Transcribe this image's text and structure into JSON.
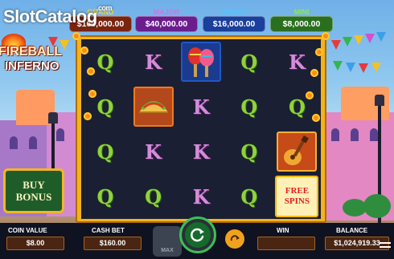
{
  "site_logo": {
    "text": "SlotCatalog",
    "suffix": ".com"
  },
  "game_logo": {
    "line1": "FIREBALL",
    "line2": "INFERNO"
  },
  "jackpots": [
    {
      "label": "GRAND",
      "value": "$160,000.00",
      "color": "#f8d037"
    },
    {
      "label": "MAJOR",
      "value": "$40,000.00",
      "color": "#d86fe8"
    },
    {
      "label": "MINOR",
      "value": "$16,000.00",
      "color": "#4fc4ff"
    },
    {
      "label": "MINI",
      "value": "$8,000.00",
      "color": "#8fe45a"
    }
  ],
  "reels": [
    [
      "Q",
      "K",
      "maracas",
      "Q",
      "K"
    ],
    [
      "Q",
      "taco",
      "K",
      "Q",
      "Q"
    ],
    [
      "Q",
      "K",
      "K",
      "Q",
      "guitar"
    ],
    [
      "Q",
      "Q",
      "K",
      "Q",
      "free-spins"
    ]
  ],
  "free_spins_label": [
    "FREE",
    "SPINS"
  ],
  "buy_bonus": {
    "line1": "BUY",
    "line2": "BONUS"
  },
  "bottom_bar": {
    "coin_value_label": "COIN VALUE",
    "coin_value": "$8.00",
    "cash_bet_label": "CASH BET",
    "cash_bet": "$160.00",
    "max_label": "MAX",
    "win_label": "WIN",
    "win_value": "",
    "balance_label": "BALANCE",
    "balance_value": "$1,024,919.33"
  },
  "colors": {
    "frame": "#f3b31b",
    "reel_bg": "#1b1f33",
    "spin_accent": "#3cbf56"
  }
}
